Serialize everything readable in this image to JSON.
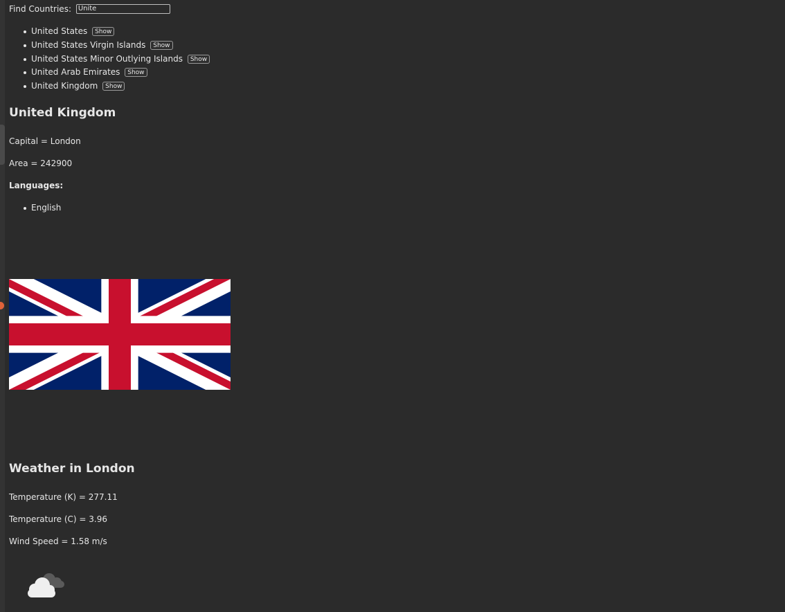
{
  "search": {
    "label": "Find Countries:",
    "value": "Unite"
  },
  "results": [
    {
      "name": "United States",
      "button": "Show"
    },
    {
      "name": "United States Virgin Islands",
      "button": "Show"
    },
    {
      "name": "United States Minor Outlying Islands",
      "button": "Show"
    },
    {
      "name": "United Arab Emirates",
      "button": "Show"
    },
    {
      "name": "United Kingdom",
      "button": "Show"
    }
  ],
  "country": {
    "name": "United Kingdom",
    "capital_line": "Capital = London",
    "area_line": "Area = 242900",
    "languages_heading": "Languages:",
    "languages": [
      "English"
    ],
    "flag_icon": "union-jack-flag"
  },
  "weather": {
    "heading": "Weather in London",
    "temp_k_line": "Temperature (K) = 277.11",
    "temp_c_line": "Temperature (C) = 3.96",
    "wind_line": "Wind Speed = 1.58 m/s",
    "icon": "cloudy-icon"
  },
  "colors": {
    "background": "#2b2b2b",
    "text": "#e6e6e6",
    "flag_blue": "#012169",
    "flag_red": "#C8102E",
    "accent_dot": "#e0633a"
  }
}
